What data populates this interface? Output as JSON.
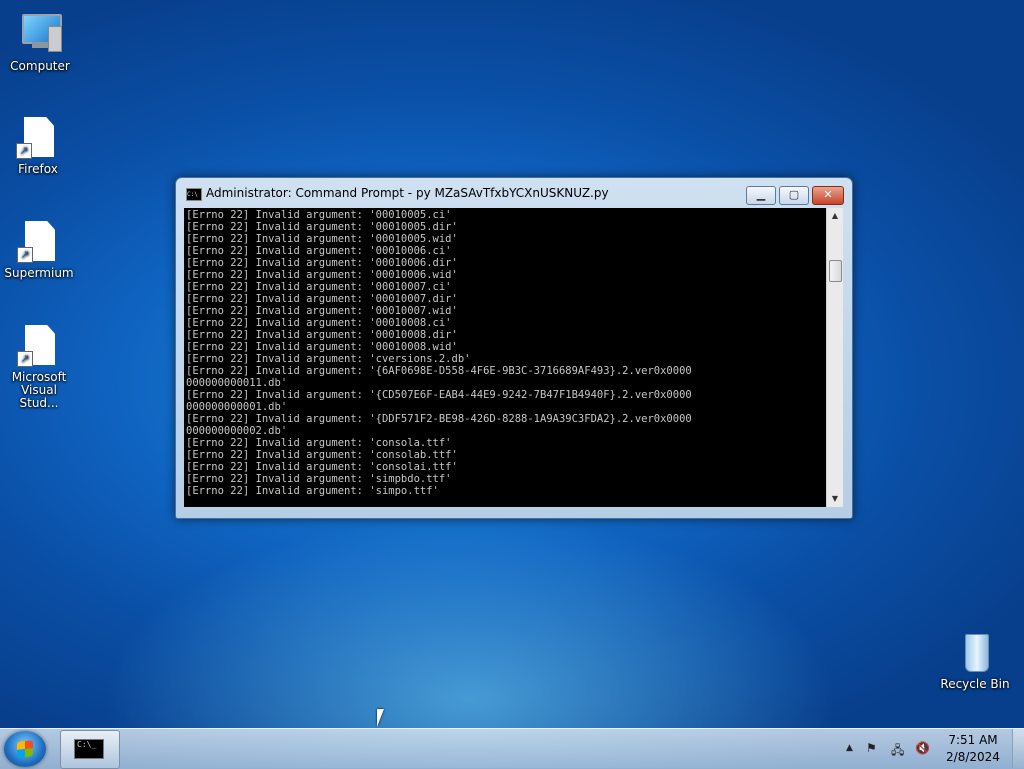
{
  "desktop": {
    "icons": [
      {
        "label": "Computer",
        "icon": "computer-icon"
      },
      {
        "label": "Firefox",
        "icon": "file-shortcut-icon"
      },
      {
        "label": "Supermium",
        "icon": "file-shortcut-icon"
      },
      {
        "label": "Microsoft Visual Stud...",
        "icon": "file-shortcut-icon"
      },
      {
        "label": "Recycle Bin",
        "icon": "recycle-bin-icon"
      }
    ]
  },
  "window": {
    "title": "Administrator:  Command Prompt - py  MZaSAvTfxbYCXnUSKNUZ.py",
    "icon_text": "C:\\",
    "min_label": "▁",
    "max_label": "▢",
    "close_label": "✕",
    "console_lines": [
      "[Errno 22] Invalid argument: '00010005.ci'",
      "[Errno 22] Invalid argument: '00010005.dir'",
      "[Errno 22] Invalid argument: '00010005.wid'",
      "[Errno 22] Invalid argument: '00010006.ci'",
      "[Errno 22] Invalid argument: '00010006.dir'",
      "[Errno 22] Invalid argument: '00010006.wid'",
      "[Errno 22] Invalid argument: '00010007.ci'",
      "[Errno 22] Invalid argument: '00010007.dir'",
      "[Errno 22] Invalid argument: '00010007.wid'",
      "[Errno 22] Invalid argument: '00010008.ci'",
      "[Errno 22] Invalid argument: '00010008.dir'",
      "[Errno 22] Invalid argument: '00010008.wid'",
      "[Errno 22] Invalid argument: 'cversions.2.db'",
      "[Errno 22] Invalid argument: '{6AF0698E-D558-4F6E-9B3C-3716689AF493}.2.ver0x0000",
      "000000000011.db'",
      "[Errno 22] Invalid argument: '{CD507E6F-EAB4-44E9-9242-7B47F1B4940F}.2.ver0x0000",
      "000000000001.db'",
      "[Errno 22] Invalid argument: '{DDF571F2-BE98-426D-8288-1A9A39C3FDA2}.2.ver0x0000",
      "000000000002.db'",
      "[Errno 22] Invalid argument: 'consola.ttf'",
      "[Errno 22] Invalid argument: 'consolab.ttf'",
      "[Errno 22] Invalid argument: 'consolai.ttf'",
      "[Errno 22] Invalid argument: 'simpbdo.ttf'",
      "[Errno 22] Invalid argument: 'simpo.ttf'"
    ],
    "scroll_up": "▲",
    "scroll_down": "▼"
  },
  "taskbar": {
    "task_icon_text": "C:\\_",
    "tray": {
      "show_hidden": "▲",
      "flag_icon": "⚑",
      "network_icon": "🖧",
      "volume_icon": "🔇"
    },
    "clock_time": "7:51 AM",
    "clock_date": "2/8/2024"
  }
}
